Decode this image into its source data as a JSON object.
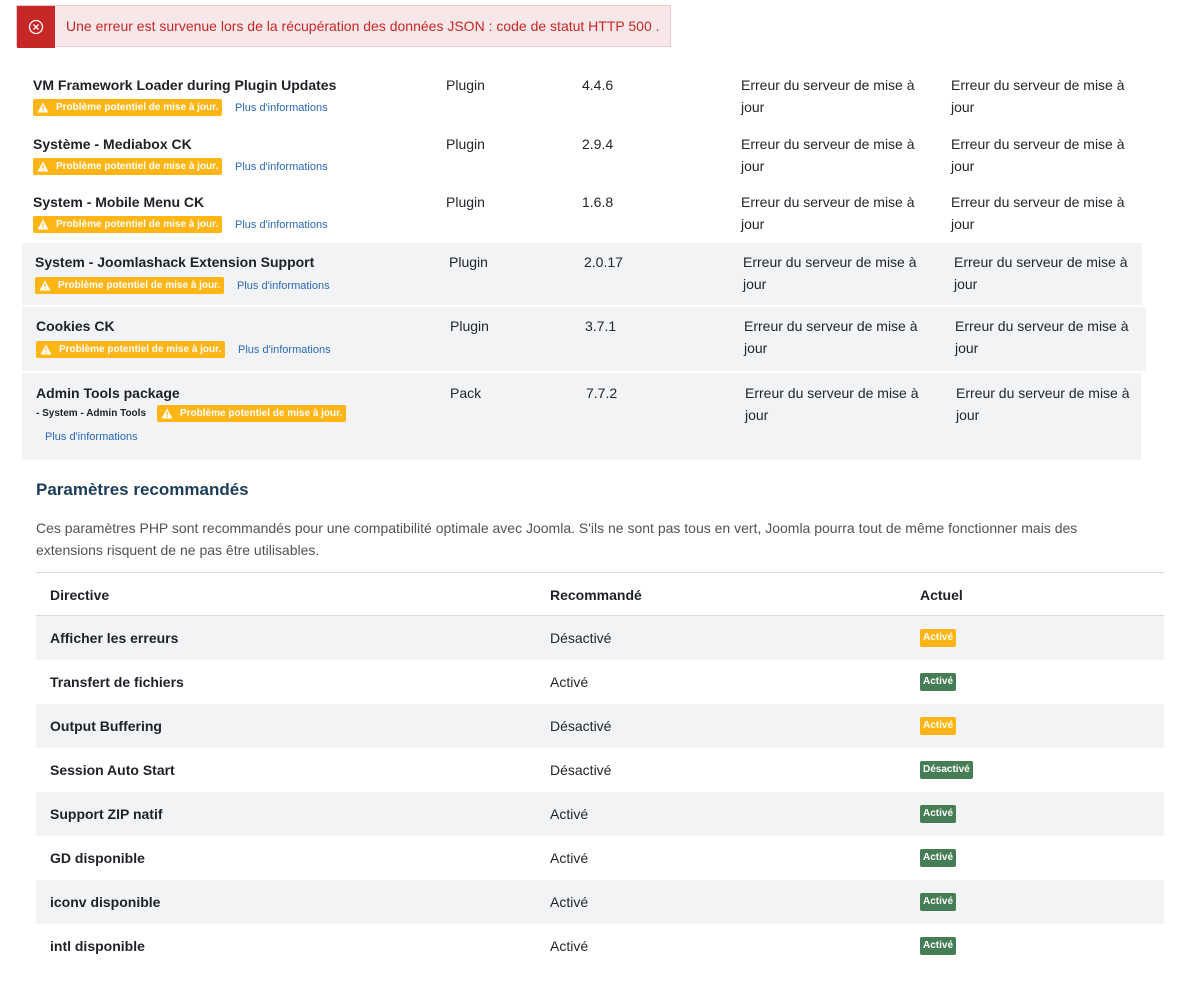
{
  "alert": {
    "message": "Une erreur est survenue lors de la récupération des données JSON : code de statut HTTP 500 .",
    "icon": "circle-x-icon",
    "color": "#c52827"
  },
  "extensions": {
    "warning_label": "Problème potentiel de mise à jour.",
    "info_label": "Plus d'informations",
    "rows": [
      {
        "name": "VM Framework Loader during Plugin Updates",
        "type": "Plugin",
        "version": "4.4.6",
        "status1": "Erreur du serveur de mise à jour",
        "status2": "Erreur du serveur de mise à jour"
      },
      {
        "name": "Système - Mediabox CK",
        "type": "Plugin",
        "version": "2.9.4",
        "status1": "Erreur du serveur de mise à jour",
        "status2": "Erreur du serveur de mise à jour"
      },
      {
        "name": "System - Mobile Menu CK",
        "type": "Plugin",
        "version": "1.6.8",
        "status1": "Erreur du serveur de mise à jour",
        "status2": "Erreur du serveur de mise à jour"
      },
      {
        "name": "System - Joomlashack Extension Support",
        "type": "Plugin",
        "version": "2.0.17",
        "status1": "Erreur du serveur de mise à jour",
        "status2": "Erreur du serveur de mise à jour"
      },
      {
        "name": "Cookies CK",
        "type": "Plugin",
        "version": "3.7.1",
        "status1": "Erreur du serveur de mise à jour",
        "status2": "Erreur du serveur de mise à jour"
      },
      {
        "name": "Admin Tools package",
        "type": "Pack",
        "version": "7.7.2",
        "status1": "Erreur du serveur de mise à jour",
        "status2": "Erreur du serveur de mise à jour",
        "sub": "- System - Admin Tools"
      }
    ]
  },
  "recommended": {
    "heading": "Paramètres recommandés",
    "description": "Ces paramètres PHP sont recommandés pour une compatibilité optimale avec Joomla. S'ils ne sont pas tous en vert, Joomla pourra tout de même fonctionner mais des extensions risquent de ne pas être utilisables.",
    "columns": {
      "directive": "Directive",
      "recommended": "Recommandé",
      "current": "Actuel"
    },
    "rows": [
      {
        "directive": "Afficher les erreurs",
        "recommended": "Désactivé",
        "current": "Activé",
        "ok": false
      },
      {
        "directive": "Transfert de fichiers",
        "recommended": "Activé",
        "current": "Activé",
        "ok": true
      },
      {
        "directive": "Output Buffering",
        "recommended": "Désactivé",
        "current": "Activé",
        "ok": false
      },
      {
        "directive": "Session Auto Start",
        "recommended": "Désactivé",
        "current": "Désactivé",
        "ok": true
      },
      {
        "directive": "Support ZIP natif",
        "recommended": "Activé",
        "current": "Activé",
        "ok": true
      },
      {
        "directive": "GD disponible",
        "recommended": "Activé",
        "current": "Activé",
        "ok": true
      },
      {
        "directive": "iconv disponible",
        "recommended": "Activé",
        "current": "Activé",
        "ok": true
      },
      {
        "directive": "intl disponible",
        "recommended": "Activé",
        "current": "Activé",
        "ok": true
      }
    ]
  },
  "colors": {
    "warning": "#ffb514",
    "success": "#457d54",
    "link": "#2a69b8",
    "heading": "#1c3d5a"
  }
}
